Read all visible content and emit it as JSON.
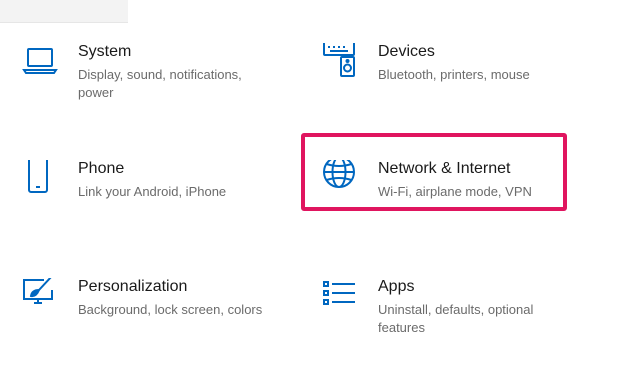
{
  "accent_color": "#0067c0",
  "highlight_color": "#e0155f",
  "tiles": {
    "system": {
      "title": "System",
      "description": "Display, sound, notifications, power",
      "icon": "laptop-icon"
    },
    "devices": {
      "title": "Devices",
      "description": "Bluetooth, printers, mouse",
      "icon": "devices-icon"
    },
    "phone": {
      "title": "Phone",
      "description": "Link your Android, iPhone",
      "icon": "phone-icon"
    },
    "network": {
      "title": "Network & Internet",
      "description": "Wi-Fi, airplane mode, VPN",
      "icon": "globe-icon"
    },
    "personalization": {
      "title": "Personalization",
      "description": "Background, lock screen, colors",
      "icon": "paint-brush-icon"
    },
    "apps": {
      "title": "Apps",
      "description": "Uninstall, defaults, optional features",
      "icon": "apps-list-icon"
    }
  }
}
